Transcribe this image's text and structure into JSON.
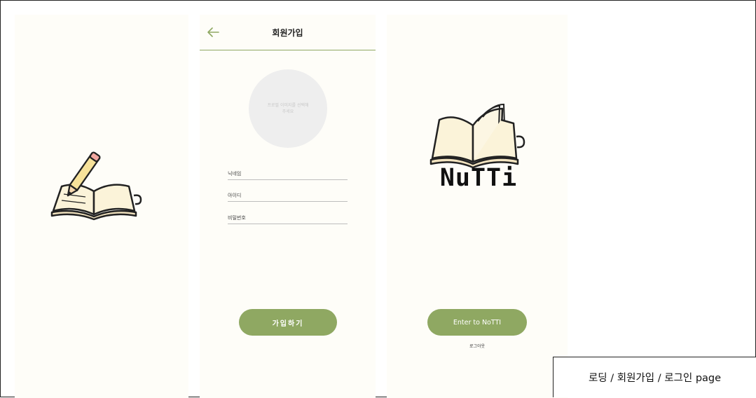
{
  "signup": {
    "title": "회원가입",
    "avatar_placeholder": "프로필 이미지를 선택해주세요",
    "fields": [
      "닉네임",
      "아이디",
      "비밀번호"
    ],
    "submit": "가입하기"
  },
  "home": {
    "logo": "NuTTi",
    "enter": "Enter to NoTTI",
    "logout": "로그아웃"
  },
  "caption": "로딩 / 회원가입 / 로그인 page",
  "colors": {
    "accent": "#8fa862",
    "screen_bg": "#fefdf8",
    "avatar_bg": "#eeeeee",
    "page_bg": "#ffffff"
  },
  "icons": {
    "back": "arrow-left-icon",
    "loading_illustration": "book-pencil-icon",
    "logo_illustration": "open-book-icon"
  }
}
